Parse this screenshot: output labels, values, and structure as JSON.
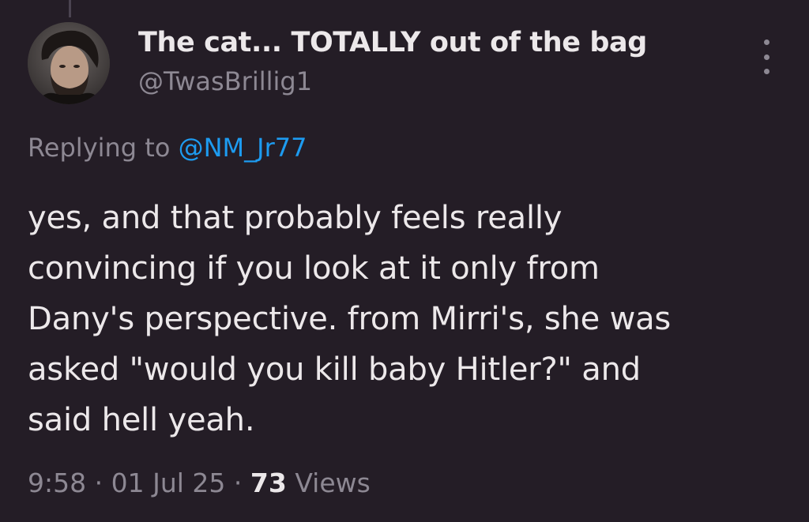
{
  "author": {
    "display_name": "The cat... TOTALLY out of the bag",
    "handle": "@TwasBrillig1",
    "avatar": "profile-photo"
  },
  "reply": {
    "prefix": "Replying to",
    "mention": "@NM_Jr77"
  },
  "tweet": {
    "lines": [
      "yes, and that probably feels really",
      "convincing if you look at it only from",
      "Dany's perspective. from Mirri's, she was",
      "asked \"would you kill baby Hitler?\" and",
      "said hell yeah."
    ]
  },
  "meta": {
    "time": "9:58",
    "separator": "·",
    "date": "01 Jul 25",
    "views_count": "73",
    "views_label": "Views"
  },
  "icons": {
    "more": "more-vertical-icon"
  },
  "colors": {
    "background": "#241d26",
    "text": "#ece8ea",
    "secondary": "#8d8893",
    "link": "#1d9bf0"
  }
}
